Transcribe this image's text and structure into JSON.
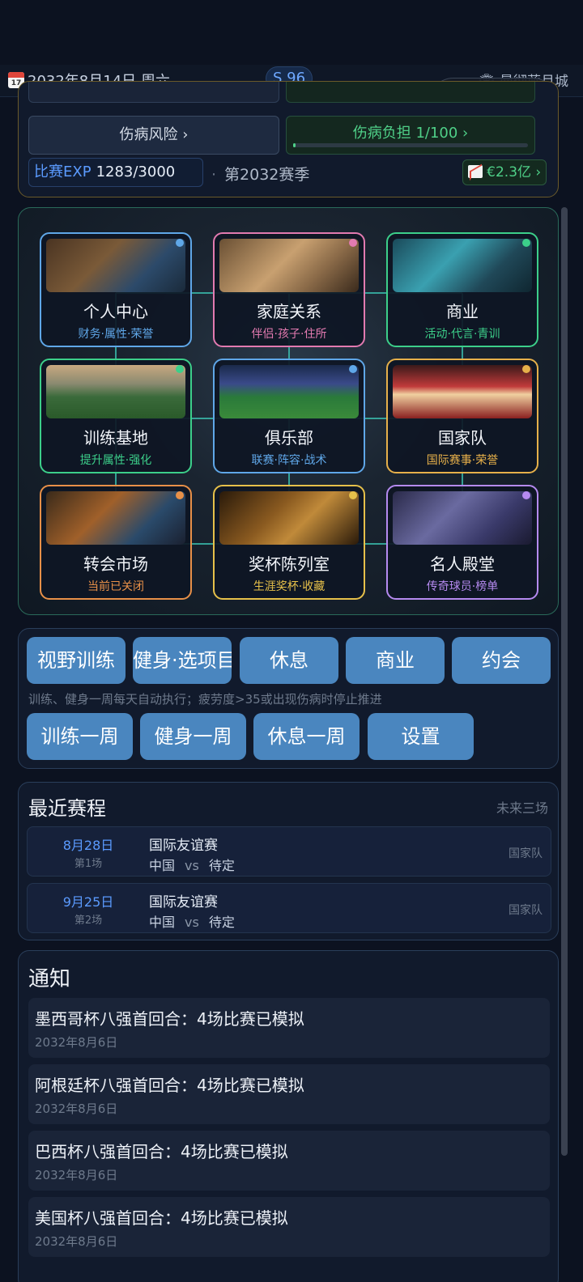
{
  "topbar": {
    "date": "2032年8月14日 周六",
    "calendar_day": "17",
    "season_badge": "S 96",
    "club": "🏟 曼彻蓝月城"
  },
  "capsule": {
    "more": "•••"
  },
  "status": {
    "injury_risk": "伤病风险 ›",
    "injury_load": "伤病负担 1/100 ›",
    "injury_load_fraction": 0.01,
    "exp_label": "比赛EXP",
    "exp_value": "1283/3000",
    "season": "第2032赛季",
    "market_value": "€2.3亿 ›"
  },
  "hub": {
    "tiles": [
      {
        "name": "个人中心",
        "sub": "财务·属性·荣誉",
        "border": "#5fa7e8",
        "sub_color": "#5fa7e8",
        "dot": "#5fa7e8"
      },
      {
        "name": "家庭关系",
        "sub": "伴侣·孩子·住所",
        "border": "#e27ab0",
        "sub_color": "#e27ab0",
        "dot": "#e27ab0"
      },
      {
        "name": "商业",
        "sub": "活动·代言·青训",
        "border": "#3ccf8a",
        "sub_color": "#3ccf8a",
        "dot": "#3ccf8a"
      },
      {
        "name": "训练基地",
        "sub": "提升属性·强化",
        "border": "#3ccf8a",
        "sub_color": "#3ccf8a",
        "dot": "#3ccf8a"
      },
      {
        "name": "俱乐部",
        "sub": "联赛·阵容·战术",
        "border": "#5fa7e8",
        "sub_color": "#5fa7e8",
        "dot": "#5fa7e8"
      },
      {
        "name": "国家队",
        "sub": "国际赛事·荣誉",
        "border": "#e6b04a",
        "sub_color": "#e6b04a",
        "dot": "#e6b04a"
      },
      {
        "name": "转会市场",
        "sub": "当前已关闭",
        "border": "#e89048",
        "sub_color": "#e89048",
        "dot": "#e89048"
      },
      {
        "name": "奖杯陈列室",
        "sub": "生涯奖杯·收藏",
        "border": "#e6c04a",
        "sub_color": "#e6c04a",
        "dot": "#e6c04a"
      },
      {
        "name": "名人殿堂",
        "sub": "传奇球员·榜单",
        "border": "#b58af0",
        "sub_color": "#b58af0",
        "dot": "#b58af0"
      }
    ]
  },
  "actions": {
    "row1": [
      "视野训练",
      "健身·选项目",
      "休息",
      "商业",
      "约会"
    ],
    "hint": "训练、健身一周每天自动执行；疲劳度>35或出现伤病时停止推进",
    "row2": [
      "训练一周",
      "健身一周",
      "休息一周",
      "设置"
    ]
  },
  "schedule": {
    "title": "最近赛程",
    "subtitle": "未来三场",
    "matches": [
      {
        "date": "8月28日",
        "round": "第1场",
        "competition": "国际友谊赛",
        "home": "中国",
        "vs": "vs",
        "away": "待定",
        "tag": "国家队"
      },
      {
        "date": "9月25日",
        "round": "第2场",
        "competition": "国际友谊赛",
        "home": "中国",
        "vs": "vs",
        "away": "待定",
        "tag": "国家队"
      }
    ]
  },
  "notices": {
    "title": "通知",
    "items": [
      {
        "text": "墨西哥杯八强首回合：4场比赛已模拟",
        "date": "2032年8月6日"
      },
      {
        "text": "阿根廷杯八强首回合：4场比赛已模拟",
        "date": "2032年8月6日"
      },
      {
        "text": "巴西杯八强首回合：4场比赛已模拟",
        "date": "2032年8月6日"
      },
      {
        "text": "美国杯八强首回合：4场比赛已模拟",
        "date": "2032年8月6日"
      }
    ]
  }
}
